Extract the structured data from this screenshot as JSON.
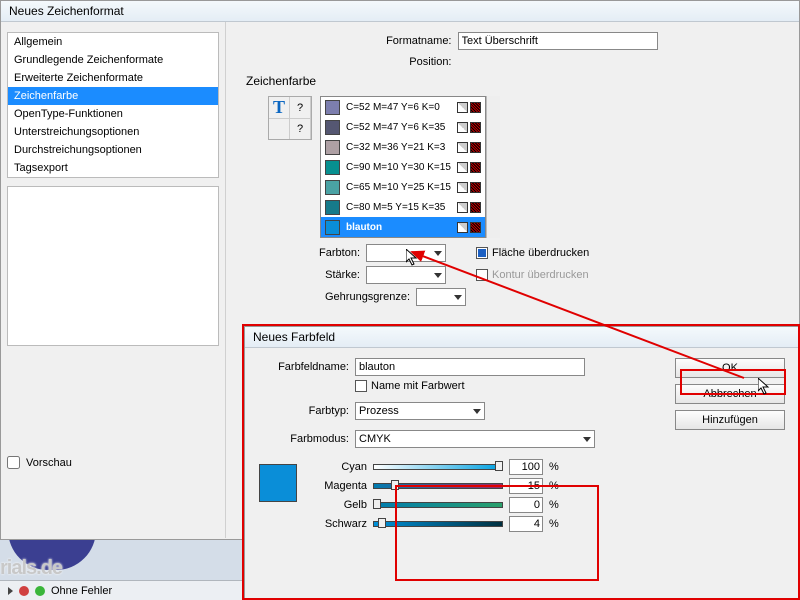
{
  "main_dialog": {
    "title": "Neues Zeichenformat",
    "sidebar": {
      "items": [
        "Allgemein",
        "Grundlegende Zeichenformate",
        "Erweiterte Zeichenformate",
        "Zeichenfarbe",
        "OpenType-Funktionen",
        "Unterstreichungsoptionen",
        "Durchstreichungsoptionen",
        "Tagsexport"
      ],
      "selected_index": 3,
      "preview_label": "Vorschau"
    },
    "formatname_label": "Formatname:",
    "formatname_value": "Text Überschrift",
    "position_label": "Position:",
    "section_title": "Zeichenfarbe",
    "swatches": [
      {
        "name": "C=52 M=47 Y=6 K=0",
        "color": "#7c7eae"
      },
      {
        "name": "C=52 M=47 Y=6 K=35",
        "color": "#555772"
      },
      {
        "name": "C=32 M=36 Y=21 K=3",
        "color": "#aea0a4"
      },
      {
        "name": "C=90 M=10 Y=30 K=15",
        "color": "#089090"
      },
      {
        "name": "C=65 M=10 Y=25 K=15",
        "color": "#4aa2a4"
      },
      {
        "name": "C=80 M=5 Y=15 K=35",
        "color": "#167a8a"
      },
      {
        "name": "blauton",
        "color": "#0a8ed8",
        "selected": true
      }
    ],
    "opts": {
      "farbton_label": "Farbton:",
      "staerke_label": "Stärke:",
      "gehrung_label": "Gehrungsgrenze:",
      "flaeche_label": "Fläche überdrucken",
      "kontur_label": "Kontur überdrucken"
    }
  },
  "swatch_dialog": {
    "title": "Neues Farbfeld",
    "farbfeldname_label": "Farbfeldname:",
    "farbfeldname_value": "blauton",
    "name_mit_farbwert_label": "Name mit Farbwert",
    "farbtyp_label": "Farbtyp:",
    "farbtyp_value": "Prozess",
    "farbmodus_label": "Farbmodus:",
    "farbmodus_value": "CMYK",
    "channels": {
      "cyan": {
        "label": "Cyan",
        "value": "100"
      },
      "magenta": {
        "label": "Magenta",
        "value": "15"
      },
      "gelb": {
        "label": "Gelb",
        "value": "0"
      },
      "schwarz": {
        "label": "Schwarz",
        "value": "4"
      }
    },
    "buttons": {
      "ok": "OK",
      "cancel": "Abbrechen",
      "add": "Hinzufügen"
    }
  },
  "status": {
    "text": "Ohne Fehler"
  },
  "watermark": "rials.de",
  "misc": {
    "question": "?",
    "pct": "%",
    "t_glyph": "T"
  }
}
